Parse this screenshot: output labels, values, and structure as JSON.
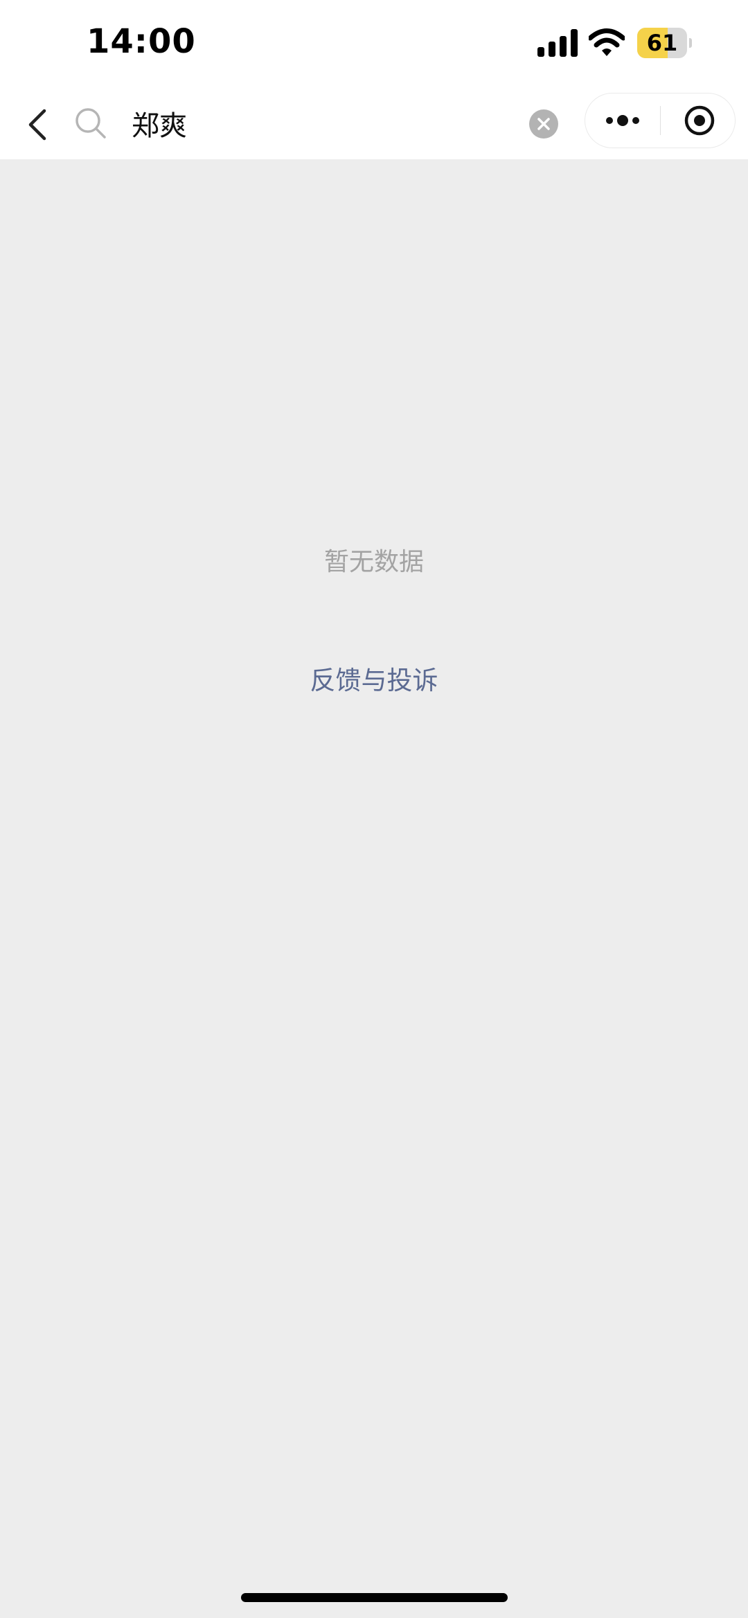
{
  "status_bar": {
    "time": "14:00",
    "battery_level": "61",
    "battery_fraction": 0.61,
    "icons": [
      "signal-icon",
      "wifi-icon",
      "battery-icon"
    ]
  },
  "search": {
    "query": "郑爽",
    "icons": [
      "back-icon",
      "search-icon",
      "clear-icon",
      "more-icon",
      "close-target-icon"
    ]
  },
  "content": {
    "empty_text": "暂无数据",
    "feedback_link": "反馈与投诉"
  },
  "colors": {
    "background": "#ededed",
    "link": "#5b6a92",
    "battery": "#f5d24a"
  }
}
